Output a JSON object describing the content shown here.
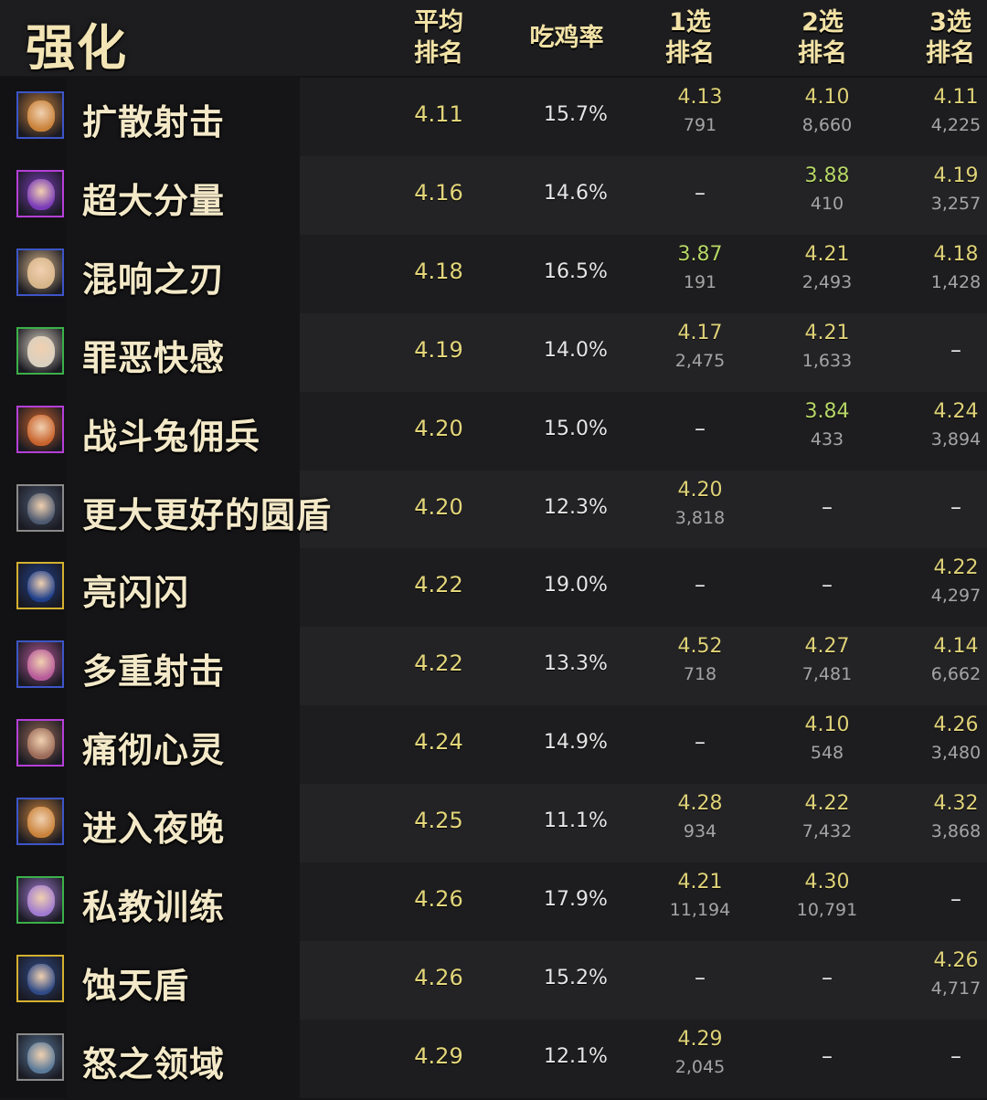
{
  "header": {
    "title": "强化",
    "col_avg_line1": "平均",
    "col_avg_line2": "排名",
    "col_top1": "吃鸡率",
    "col_p1_line1": "1选",
    "col_p1_line2": "排名",
    "col_p2_line1": "2选",
    "col_p2_line2": "排名",
    "col_p3_line1": "3选",
    "col_p3_line2": "排名"
  },
  "rows": [
    {
      "name": "扩散射击",
      "icon": "champion-portrait-icon",
      "border": "#3d55c7",
      "avg": "4.11",
      "top1": "15.7%",
      "p1": {
        "avg": "4.13",
        "count": "791"
      },
      "p2": {
        "avg": "4.10",
        "count": "8,660"
      },
      "p3": {
        "avg": "4.11",
        "count": "4,225"
      }
    },
    {
      "name": "超大分量",
      "icon": "champion-portrait-icon",
      "border": "#b53fd8",
      "avg": "4.16",
      "top1": "14.6%",
      "p1": {
        "dash": "–"
      },
      "p2": {
        "avg": "3.88",
        "count": "410"
      },
      "p3": {
        "avg": "4.19",
        "count": "3,257"
      }
    },
    {
      "name": "混响之刃",
      "icon": "champion-portrait-icon",
      "border": "#3d55c7",
      "avg": "4.18",
      "top1": "16.5%",
      "p1": {
        "avg": "3.87",
        "count": "191"
      },
      "p2": {
        "avg": "4.21",
        "count": "2,493"
      },
      "p3": {
        "avg": "4.18",
        "count": "1,428"
      }
    },
    {
      "name": "罪恶快感",
      "icon": "champion-portrait-icon",
      "border": "#3bb04a",
      "avg": "4.19",
      "top1": "14.0%",
      "p1": {
        "avg": "4.17",
        "count": "2,475"
      },
      "p2": {
        "avg": "4.21",
        "count": "1,633"
      },
      "p3": {
        "dash": "–"
      }
    },
    {
      "name": "战斗兔佣兵",
      "icon": "champion-portrait-icon",
      "border": "#b53fd8",
      "avg": "4.20",
      "top1": "15.0%",
      "p1": {
        "dash": "–"
      },
      "p2": {
        "avg": "3.84",
        "count": "433"
      },
      "p3": {
        "avg": "4.24",
        "count": "3,894"
      }
    },
    {
      "name": "更大更好的圆盾",
      "icon": "champion-portrait-icon",
      "border": "#8a8a8a",
      "avg": "4.20",
      "top1": "12.3%",
      "p1": {
        "avg": "4.20",
        "count": "3,818"
      },
      "p2": {
        "dash": "–"
      },
      "p3": {
        "dash": "–"
      }
    },
    {
      "name": "亮闪闪",
      "icon": "champion-portrait-icon",
      "border": "#d4b030",
      "avg": "4.22",
      "top1": "19.0%",
      "p1": {
        "dash": "–"
      },
      "p2": {
        "dash": "–"
      },
      "p3": {
        "avg": "4.22",
        "count": "4,297"
      }
    },
    {
      "name": "多重射击",
      "icon": "champion-portrait-icon",
      "border": "#3d55c7",
      "avg": "4.22",
      "top1": "13.3%",
      "p1": {
        "avg": "4.52",
        "count": "718"
      },
      "p2": {
        "avg": "4.27",
        "count": "7,481"
      },
      "p3": {
        "avg": "4.14",
        "count": "6,662"
      }
    },
    {
      "name": "痛彻心灵",
      "icon": "champion-portrait-icon",
      "border": "#b53fd8",
      "avg": "4.24",
      "top1": "14.9%",
      "p1": {
        "dash": "–"
      },
      "p2": {
        "avg": "4.10",
        "count": "548"
      },
      "p3": {
        "avg": "4.26",
        "count": "3,480"
      }
    },
    {
      "name": "进入夜晚",
      "icon": "champion-portrait-icon",
      "border": "#3d55c7",
      "avg": "4.25",
      "top1": "11.1%",
      "p1": {
        "avg": "4.28",
        "count": "934"
      },
      "p2": {
        "avg": "4.22",
        "count": "7,432"
      },
      "p3": {
        "avg": "4.32",
        "count": "3,868"
      }
    },
    {
      "name": "私教训练",
      "icon": "champion-portrait-icon",
      "border": "#3bb04a",
      "avg": "4.26",
      "top1": "17.9%",
      "p1": {
        "avg": "4.21",
        "count": "11,194"
      },
      "p2": {
        "avg": "4.30",
        "count": "10,791"
      },
      "p3": {
        "dash": "–"
      }
    },
    {
      "name": "蚀天盾",
      "icon": "champion-portrait-icon",
      "border": "#d4b030",
      "avg": "4.26",
      "top1": "15.2%",
      "p1": {
        "dash": "–"
      },
      "p2": {
        "dash": "–"
      },
      "p3": {
        "avg": "4.26",
        "count": "4,717"
      }
    },
    {
      "name": "怒之领域",
      "icon": "champion-portrait-icon",
      "border": "#8a8a8a",
      "avg": "4.29",
      "top1": "12.1%",
      "p1": {
        "avg": "4.29",
        "count": "2,045"
      },
      "p2": {
        "dash": "–"
      },
      "p3": {
        "dash": "–"
      }
    }
  ],
  "colors": {
    "gold_text": "#e3d67a",
    "green_text": "#b7d767",
    "muted": "#a4a4a4"
  }
}
